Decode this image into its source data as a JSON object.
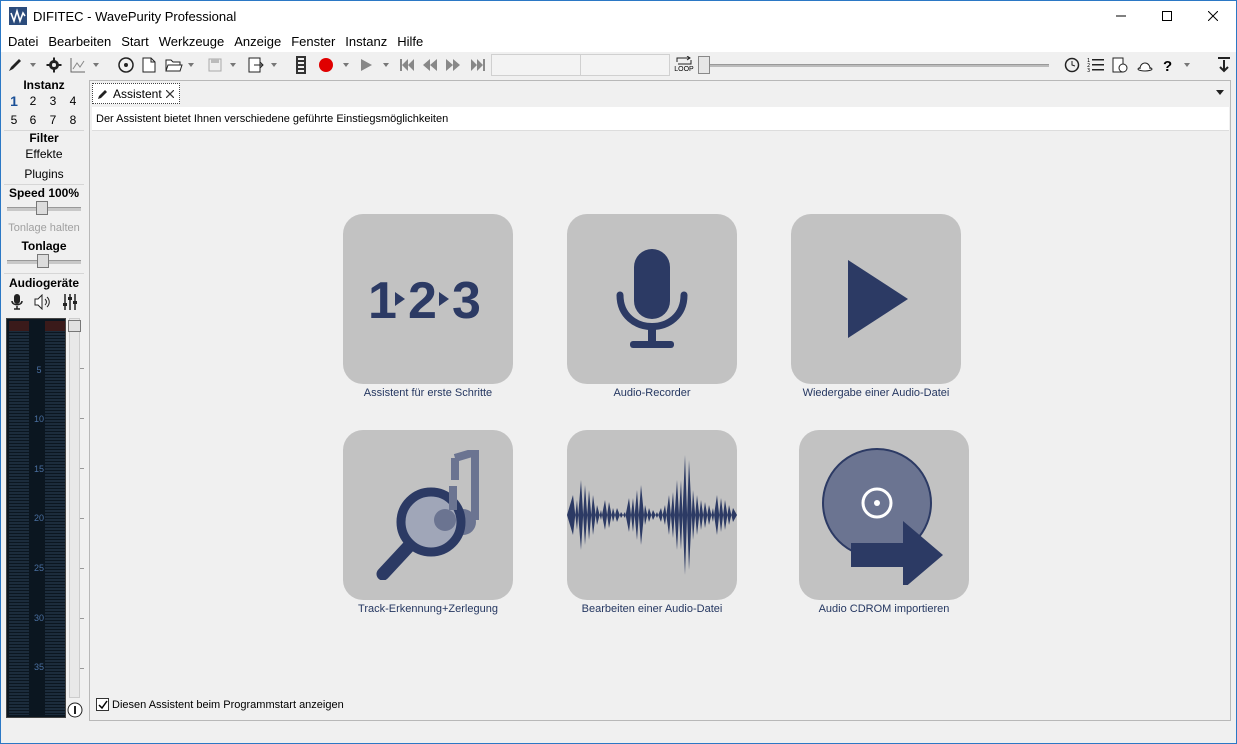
{
  "window": {
    "title": "DIFITEC - WavePurity Professional"
  },
  "menu": [
    "Datei",
    "Bearbeiten",
    "Start",
    "Werkzeuge",
    "Anzeige",
    "Fenster",
    "Instanz",
    "Hilfe"
  ],
  "toolbar": {
    "loop_label": "LOOP"
  },
  "left_panel": {
    "instanz_title": "Instanz",
    "instances": [
      "1",
      "2",
      "3",
      "4",
      "5",
      "6",
      "7",
      "8"
    ],
    "filter_title": "Filter",
    "effekte": "Effekte",
    "plugins": "Plugins",
    "speed_title": "Speed 100%",
    "tonlage_halten": "Tonlage halten",
    "tonlage_title": "Tonlage",
    "audio_title": "Audiogeräte",
    "vu_scale": [
      "5",
      "10",
      "15",
      "20",
      "25",
      "30",
      "35"
    ],
    "speed_level_percent": 100
  },
  "tabs": {
    "active_label": "Assistent"
  },
  "info_text": "Der Assistent bietet Ihnen verschiedene geführte Einstiegsmöglichkeiten",
  "tiles": [
    {
      "label": "Assistent für erste Schritte",
      "icon": "steps-123-icon"
    },
    {
      "label": "Audio-Recorder",
      "icon": "microphone-icon"
    },
    {
      "label": "Wiedergabe einer Audio-Datei",
      "icon": "play-icon"
    },
    {
      "label": "Track-Erkennung+Zerlegung",
      "icon": "search-music-icon"
    },
    {
      "label": "Bearbeiten einer Audio-Datei",
      "icon": "waveform-icon"
    },
    {
      "label": "Audio CDROM importieren",
      "icon": "cd-import-icon"
    }
  ],
  "checkbox": {
    "label": "Diesen Assistent beim Programmstart anzeigen",
    "checked": true
  },
  "colors": {
    "icon_navy": "#2c3a64",
    "tile_bg": "#c2c2c2",
    "record_red": "#e00000"
  }
}
